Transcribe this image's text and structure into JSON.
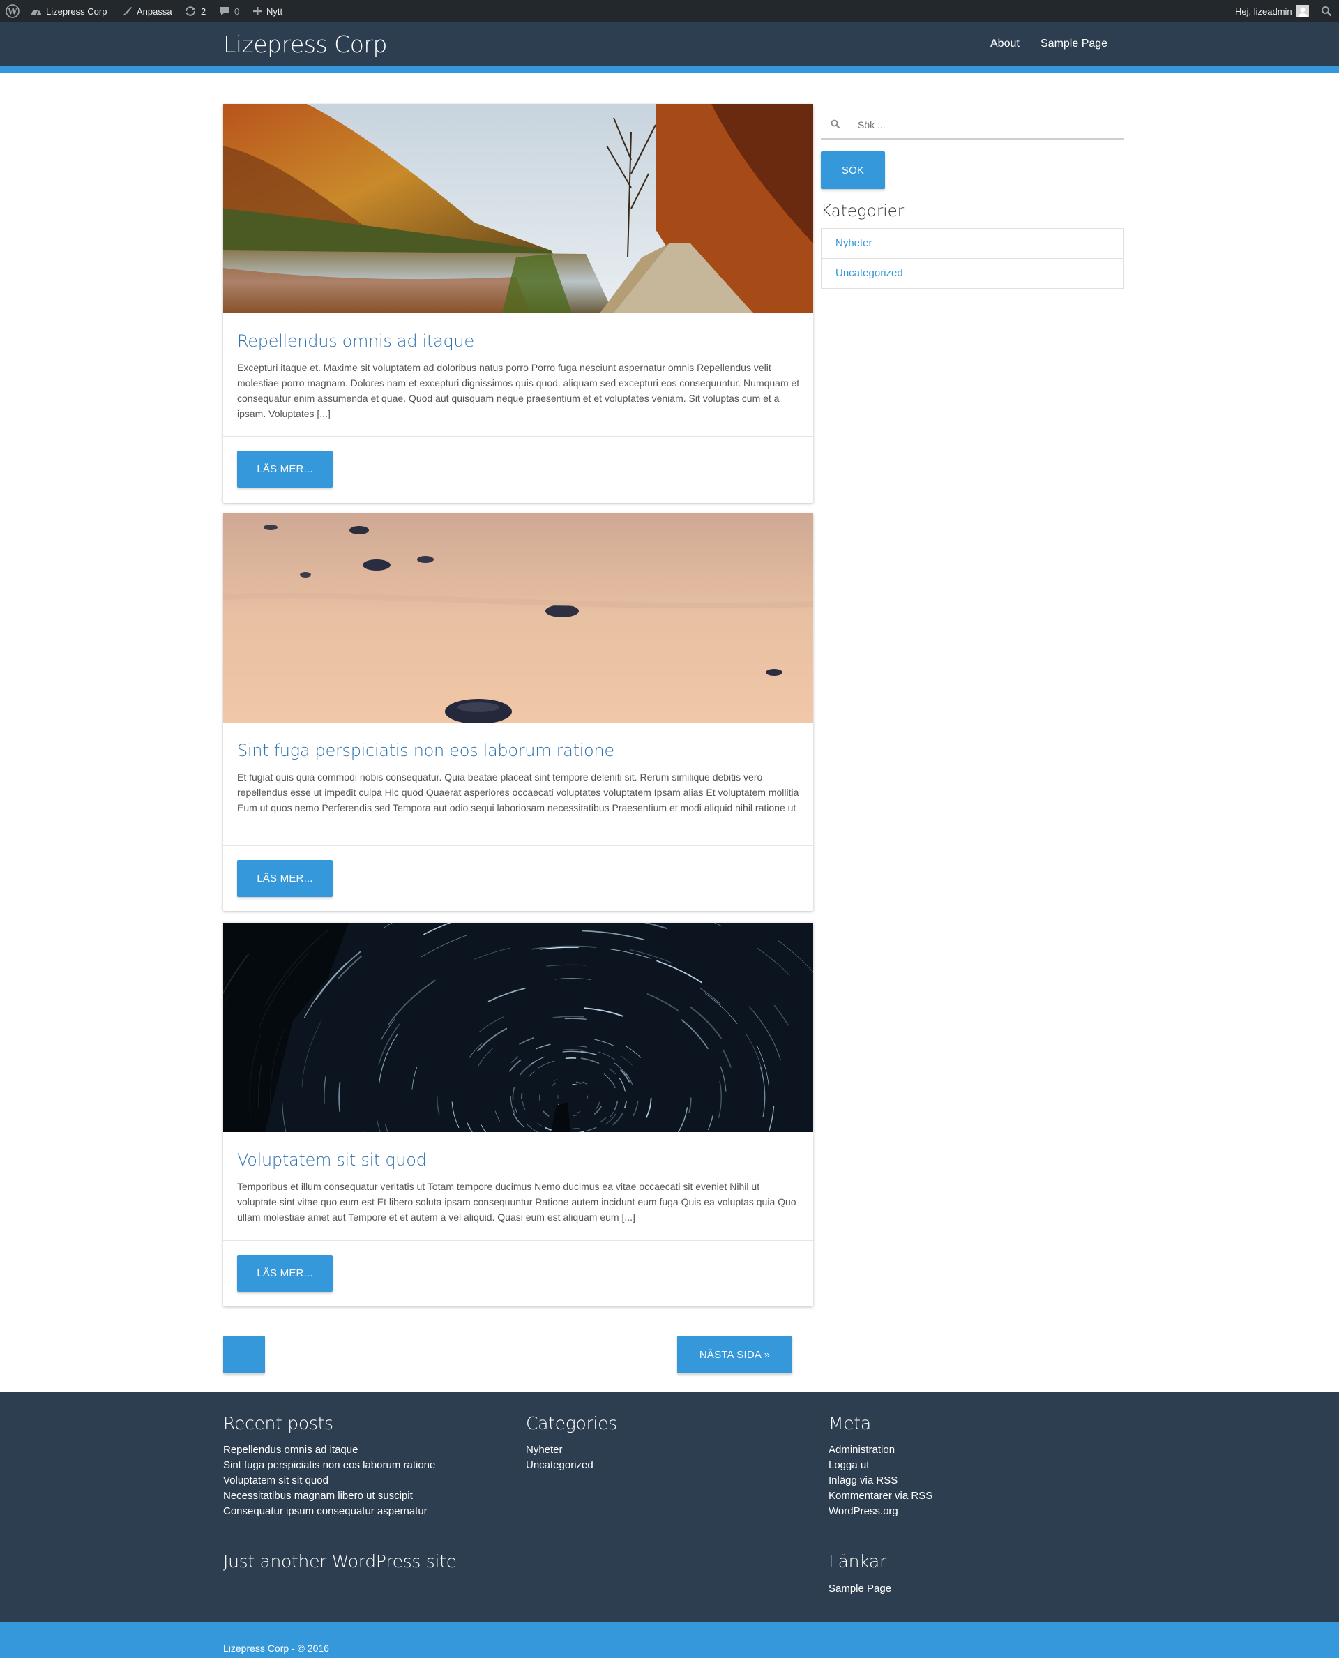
{
  "adminbar": {
    "site": "Lizepress Corp",
    "customize": "Anpassa",
    "updates": "2",
    "comments": "0",
    "new": "Nytt",
    "greeting": "Hej, lizeadmin"
  },
  "header": {
    "site_title": "Lizepress Corp",
    "nav": [
      "About",
      "Sample Page"
    ]
  },
  "posts": [
    {
      "title": "Repellendus omnis ad itaque",
      "excerpt": "Excepturi itaque et. Maxime sit voluptatem ad doloribus natus porro Porro fuga nesciunt aspernatur omnis Repellendus velit molestiae porro magnam. Dolores nam et excepturi dignissimos quis quod. aliquam sed excepturi eos consequuntur. Numquam et consequatur enim assumenda et quae. Quod aut quisquam neque praesentium et et voluptates veniam. Sit voluptas cum et a ipsam. Voluptates [...]",
      "button": "LÄS MER..."
    },
    {
      "title": "Sint fuga perspiciatis non eos laborum ratione",
      "excerpt": "Et fugiat quis quia commodi nobis consequatur. Quia beatae placeat sint tempore deleniti sit. Rerum similique debitis vero repellendus esse ut impedit culpa Hic quod Quaerat asperiores occaecati voluptates voluptatem Ipsam alias Et voluptatem mollitia Eum ut quos nemo Perferendis sed Tempora aut odio sequi laboriosam necessitatibus Praesentium et modi aliquid nihil ratione ut",
      "button": "LÄS MER..."
    },
    {
      "title": "Voluptatem sit sit quod",
      "excerpt": "Temporibus et illum consequatur veritatis ut Totam tempore ducimus Nemo ducimus ea vitae occaecati sit eveniet Nihil ut voluptate sint vitae quo eum est Et libero soluta ipsam consequuntur Ratione autem incidunt eum fuga Quis ea voluptas quia Quo ullam molestiae amet aut Tempore et et autem a vel aliquid. Quasi eum est aliquam eum [...]",
      "button": "LÄS MER..."
    }
  ],
  "pagination": {
    "next": "NÄSTA SIDA »"
  },
  "sidebar": {
    "search_placeholder": "Sök ...",
    "search_button": "SÖK",
    "categories_title": "Kategorier",
    "categories": [
      "Nyheter",
      "Uncategorized"
    ]
  },
  "footer": {
    "recent_title": "Recent posts",
    "recent": [
      "Repellendus omnis ad itaque",
      "Sint fuga perspiciatis non eos laborum ratione",
      "Voluptatem sit sit quod",
      "Necessitatibus magnam libero ut suscipit",
      "Consequatur ipsum consequatur aspernatur"
    ],
    "categories_title": "Categories",
    "categories": [
      "Nyheter",
      "Uncategorized"
    ],
    "meta_title": "Meta",
    "meta": [
      "Administration",
      "Logga ut",
      "Inlägg via RSS",
      "Kommentarer via RSS",
      "WordPress.org"
    ],
    "tagline": "Just another WordPress site",
    "links_title": "Länkar",
    "links": [
      "Sample Page"
    ],
    "copyright": "Lizepress Corp - © 2016"
  },
  "colors": {
    "accent": "#3498db",
    "header_bg": "#2d3e50",
    "adminbar_bg": "#23282d",
    "title_blue": "#3174b0"
  }
}
